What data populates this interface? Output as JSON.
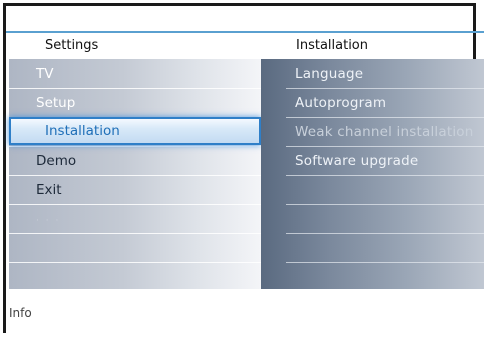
{
  "header": {
    "left_title": "Settings",
    "right_title": "Installation"
  },
  "menu": {
    "items": [
      {
        "label": "TV"
      },
      {
        "label": "Setup"
      },
      {
        "label": "Installation",
        "selected": true
      },
      {
        "label": "Demo"
      },
      {
        "label": "Exit"
      }
    ]
  },
  "submenu": {
    "items": [
      {
        "label": "Language"
      },
      {
        "label": "Autoprogram"
      },
      {
        "label": "Weak channel installation"
      },
      {
        "label": "Software upgrade"
      }
    ]
  },
  "footer": {
    "info_label": "Info"
  },
  "colors": {
    "accent": "#2f7fc8",
    "header_rule": "#5aa0d0"
  }
}
